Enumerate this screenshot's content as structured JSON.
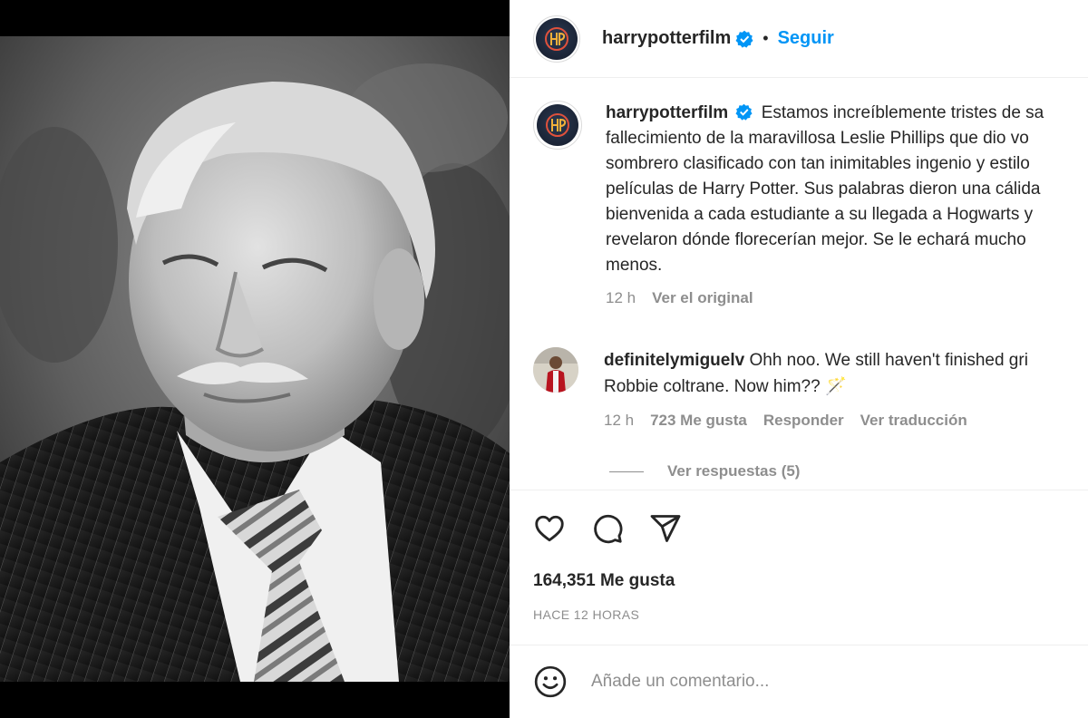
{
  "header": {
    "username": "harrypotterfilm",
    "separator": "•",
    "follow_label": "Seguir"
  },
  "caption": {
    "username": "harrypotterfilm",
    "lines": [
      "Estamos increíblemente tristes de sa",
      "fallecimiento de la maravillosa Leslie Phillips que dio vo",
      "sombrero clasificado con tan inimitables ingenio y estilo",
      "películas de Harry Potter. Sus palabras dieron una cálida",
      "bienvenida a cada estudiante a su llegada a Hogwarts y",
      "revelaron dónde florecerían mejor. Se le echará mucho",
      "menos."
    ],
    "time": "12 h",
    "see_original": "Ver el original"
  },
  "comment": {
    "username": "definitelymiguelv",
    "line1": "Ohh noo. We still haven't finished gri",
    "line2": "Robbie coltrane. Now him??",
    "emoji": "🪄",
    "time": "12 h",
    "likes": "723 Me gusta",
    "reply": "Responder",
    "translate": "Ver traducción",
    "view_replies": "Ver respuestas (5)"
  },
  "post": {
    "likes": "164,351 Me gusta",
    "timestamp": "HACE 12 HORAS"
  },
  "add_comment": {
    "placeholder": "Añade un comentario..."
  },
  "colors": {
    "link": "#0095f6",
    "verified": "#0095f6",
    "secondary_text": "#8e8e8e"
  },
  "icons": [
    "verified-badge-icon",
    "heart-icon",
    "comment-icon",
    "share-icon",
    "emoji-icon"
  ]
}
